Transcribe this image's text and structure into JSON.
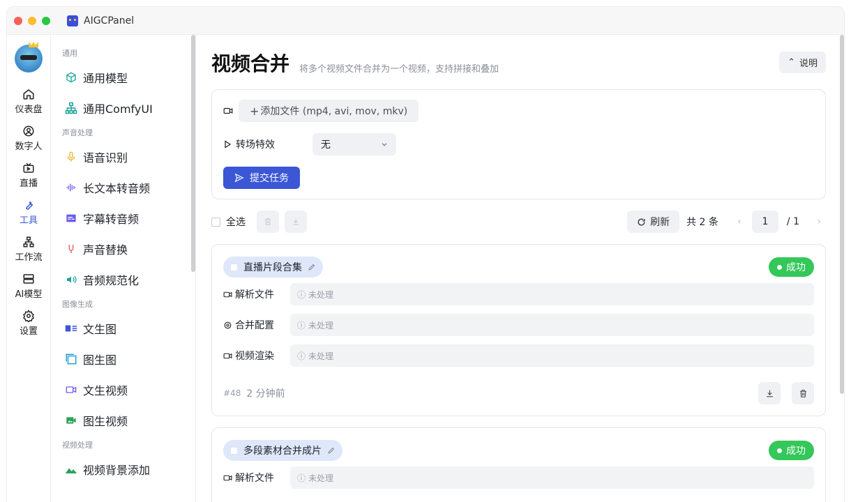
{
  "app": {
    "title": "AIGCPanel"
  },
  "rail": {
    "items": [
      {
        "label": "仪表盘",
        "icon": "home-icon"
      },
      {
        "label": "数字人",
        "icon": "user-circle-icon"
      },
      {
        "label": "直播",
        "icon": "tv-icon"
      },
      {
        "label": "工具",
        "icon": "wrench-icon",
        "active": true
      },
      {
        "label": "工作流",
        "icon": "flow-icon"
      },
      {
        "label": "AI模型",
        "icon": "server-icon"
      },
      {
        "label": "设置",
        "icon": "gear-icon"
      }
    ]
  },
  "menu": {
    "group_general": "通用",
    "general_model": "通用模型",
    "general_comfyui": "通用ComfyUI",
    "group_audio": "声音处理",
    "asr": "语音识别",
    "long_tts": "长文本转音频",
    "subtitle_tts": "字幕转音频",
    "voice_replace": "声音替换",
    "audio_normalize": "音频规范化",
    "group_image": "图像生成",
    "text_to_image": "文生图",
    "image_to_image": "图生图",
    "text_to_video": "文生视频",
    "image_to_video": "图生视频",
    "group_video": "视频处理",
    "video_bg": "视频背景添加"
  },
  "page": {
    "title": "视频合并",
    "subtitle": "将多个视频文件合并为一个视频，支持拼接和叠加",
    "help": "说明"
  },
  "form": {
    "add_file": "添加文件 (mp4, avi, mov, mkv)",
    "transition_label": "转场特效",
    "transition_value": "无",
    "submit": "提交任务"
  },
  "toolbar": {
    "select_all": "全选",
    "refresh": "刷新",
    "total": "共 2 条",
    "page_current": "1",
    "page_total": "/ 1"
  },
  "tasks": [
    {
      "name": "直播片段合集",
      "status": "成功",
      "steps": [
        {
          "label": "解析文件",
          "value": "未处理"
        },
        {
          "label": "合并配置",
          "value": "未处理"
        },
        {
          "label": "视频渲染",
          "value": "未处理"
        }
      ],
      "id": "#48",
      "time": "2 分钟前"
    },
    {
      "name": "多段素材合并成片",
      "status": "成功",
      "steps": [
        {
          "label": "解析文件",
          "value": "未处理"
        }
      ]
    }
  ],
  "colors": {
    "accent": "#3b57d6",
    "success": "#34c759"
  }
}
